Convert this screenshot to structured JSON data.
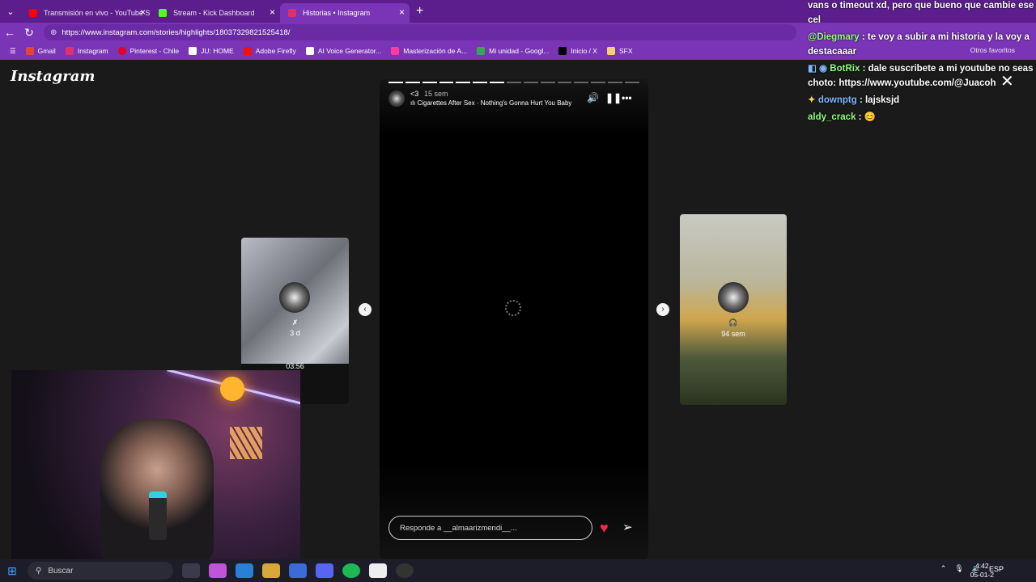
{
  "browser": {
    "tabs": [
      {
        "label": "Transmisión en vivo - YouTube Stu",
        "favicon_color": "#ff0000",
        "active": false
      },
      {
        "label": "Stream - Kick Dashboard",
        "favicon_color": "#53fc18",
        "active": false
      },
      {
        "label": "Historias • Instagram",
        "favicon_color": "#e1306c",
        "active": true
      }
    ],
    "url": "https://www.instagram.com/stories/highlights/18037329821525418/",
    "bookmarks": [
      {
        "label": "Gmail",
        "icon": "gmail-icon",
        "color": "#ea4335"
      },
      {
        "label": "Instagram",
        "icon": "instagram-icon",
        "color": "#e1306c"
      },
      {
        "label": "Pinterest - Chile",
        "icon": "pinterest-icon",
        "color": "#e60023"
      },
      {
        "label": "JU: HOME",
        "icon": "notion-icon",
        "color": "#ffffff"
      },
      {
        "label": "Adobe Firefly",
        "icon": "adobe-icon",
        "color": "#fa0f00"
      },
      {
        "label": "AI Voice Generator...",
        "icon": "elevenlabs-icon",
        "color": "#ffffff"
      },
      {
        "label": "Masterización de A...",
        "icon": "master-icon",
        "color": "#ff3aa0"
      },
      {
        "label": "Mi unidad - Googl...",
        "icon": "drive-icon",
        "color": "#34a853"
      },
      {
        "label": "Inicio / X",
        "icon": "x-icon",
        "color": "#000000"
      },
      {
        "label": "SFX",
        "icon": "folder-icon",
        "color": "#f4d36b"
      }
    ],
    "others_label": "Otros favoritos"
  },
  "instagram": {
    "logo": "Instagram",
    "story": {
      "user": "<3",
      "time": "15 sem",
      "song": "Cigarettes After Sex · Nothing's Gonna Hurt You Baby",
      "reply_placeholder": "Responde a __almaarizmendi__...",
      "progress_total": 15,
      "progress_done": 7
    },
    "prev_story": {
      "icon_label": "✗",
      "time": "3 d",
      "duration": "03:56"
    },
    "next_story": {
      "icon_label": "🎧",
      "time": "94 sem"
    }
  },
  "chat": {
    "messages": [
      {
        "user": "",
        "text": "vans o timeout xd, pero que bueno que cambie ese"
      },
      {
        "user": "",
        "text": "cel"
      },
      {
        "user": "@Diegmary",
        "text": ": te voy a subir a mi historia y la voy a"
      },
      {
        "user": "",
        "text": "destacaaar"
      },
      {
        "user": "BotRix",
        "text": ": dale suscribete a mi youtube no seas"
      },
      {
        "user": "",
        "text": "choto: https://www.youtube.com/@Juacoh"
      },
      {
        "user": "downptg",
        "text": ": lajsksjd"
      },
      {
        "user": "aldy_crack",
        "text": ": 😊"
      }
    ]
  },
  "taskbar": {
    "search_placeholder": "Buscar",
    "lang": "ESP",
    "time": "4:42",
    "date": "05-01-2"
  }
}
